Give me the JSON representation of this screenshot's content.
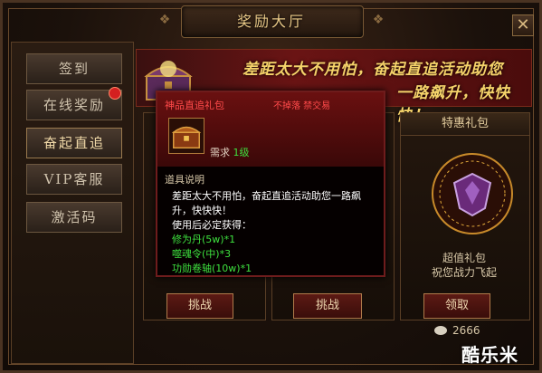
{
  "window": {
    "title": "奖励大厅",
    "close_label": "✕"
  },
  "sidebar": {
    "items": [
      {
        "label": "签到"
      },
      {
        "label": "在线奖励"
      },
      {
        "label": "奋起直追"
      },
      {
        "label": "VIP客服"
      },
      {
        "label": "激活码"
      }
    ]
  },
  "banner": {
    "line1": "差距太大不用怕，奋起直追活动助您",
    "line2": "一路飙升，快快快！"
  },
  "cards": {
    "left": {
      "button": "挑战"
    },
    "middle": {
      "button": "挑战"
    },
    "right": {
      "header": "特惠礼包",
      "sub1": "超值礼包",
      "sub2": "祝您战力飞起",
      "button": "领取",
      "price": "2666"
    }
  },
  "tooltip": {
    "name": "神品直追礼包",
    "flags": "不掉落  禁交易",
    "requirement_label": "需求",
    "requirement_value": "1级",
    "section_title": "道具说明",
    "desc_line1": "差距太大不用怕，奋起直追活动助您一路飙",
    "desc_line2": "升，快快快！",
    "desc_line3": "使用后必定获得：",
    "rewards": [
      "修为丹(5w)*1",
      "噬魂令(中)*3",
      "功勋卷轴(10w)*1"
    ]
  },
  "watermark": "酷乐米",
  "colors": {
    "accent_red": "#ff4a4a",
    "reward_green": "#3ee03e",
    "gold_text": "#f5d36a"
  }
}
